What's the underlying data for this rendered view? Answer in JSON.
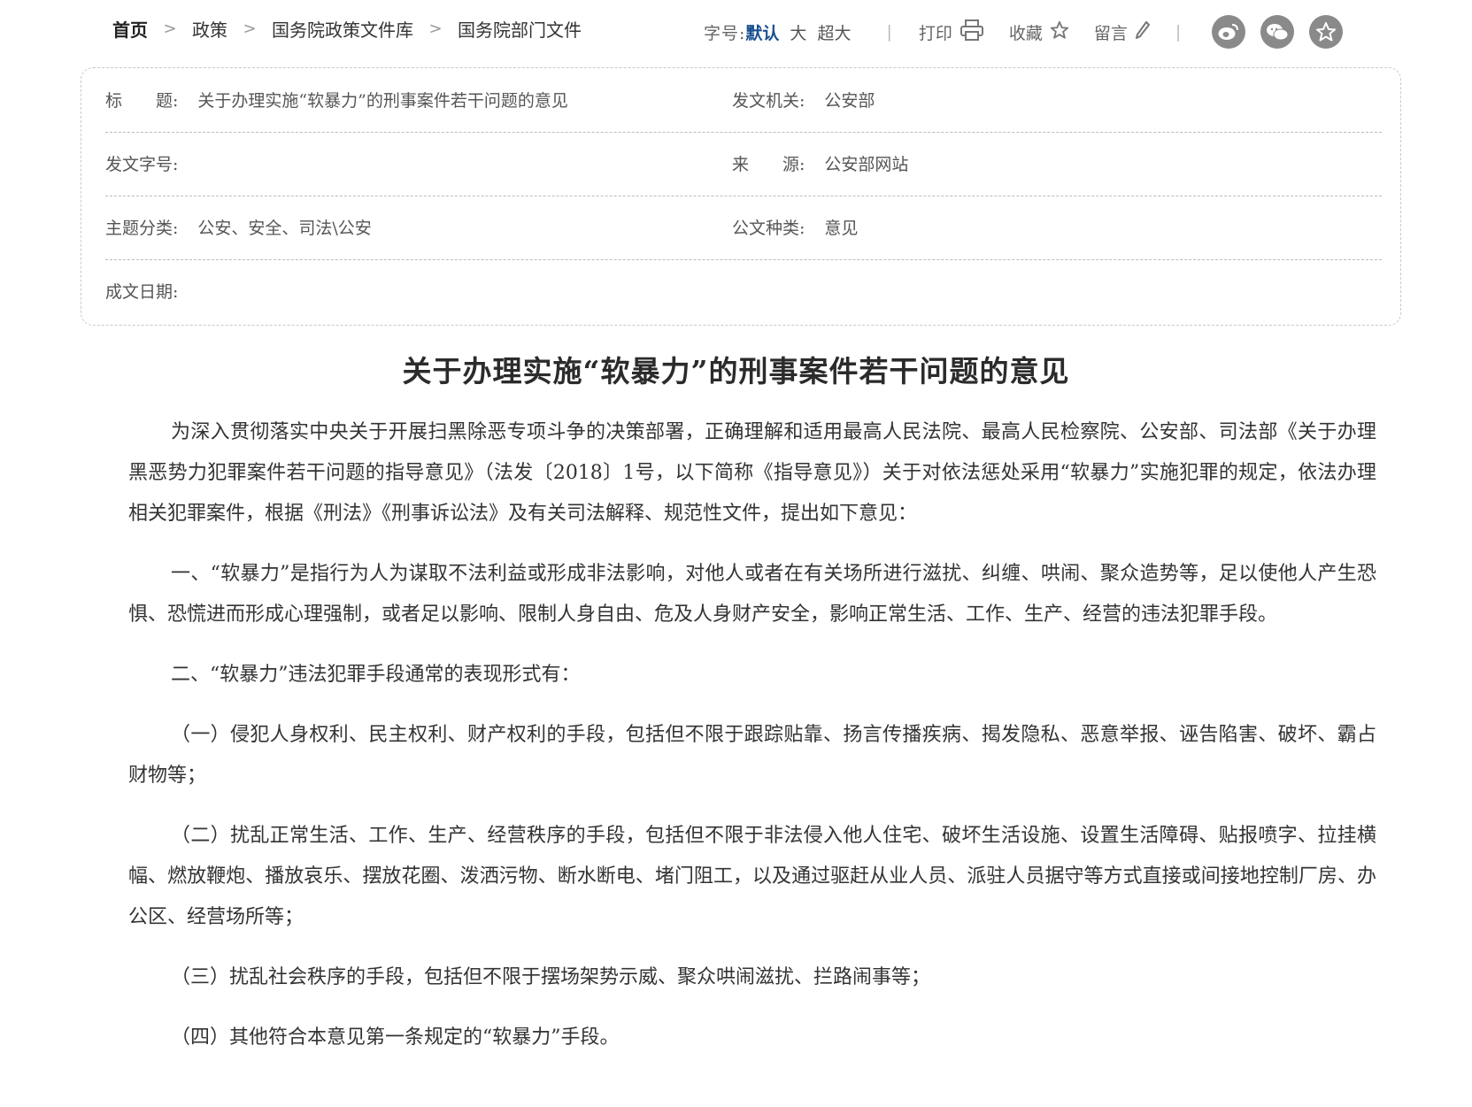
{
  "breadcrumb": {
    "home": "首页",
    "items": [
      "政策",
      "国务院政策文件库",
      "国务院部门文件"
    ],
    "separator": ">"
  },
  "toolbar": {
    "font_size_label": "字号:",
    "font_sizes": [
      "默认",
      "大",
      "超大"
    ],
    "active_font_size": "默认",
    "divider": "|",
    "print_label": "打印",
    "favorite_label": "收藏",
    "comment_label": "留言",
    "accent_color": "#1a4f8f",
    "share_icons": [
      "weibo-icon",
      "wechat-icon",
      "favorite-star-icon"
    ]
  },
  "meta": {
    "title_label": "标　　题:",
    "title_value": "关于办理实施“软暴力”的刑事案件若干问题的意见",
    "issuer_label": "发文机关:",
    "issuer_value": "公安部",
    "doc_number_label": "发文字号:",
    "doc_number_value": "",
    "source_label": "来　　源:",
    "source_value": "公安部网站",
    "topic_label": "主题分类:",
    "topic_value": "公安、安全、司法\\公安",
    "doc_type_label": "公文种类:",
    "doc_type_value": "意见",
    "date_label": "成文日期:",
    "date_value": ""
  },
  "article": {
    "title": "关于办理实施“软暴力”的刑事案件若干问题的意见",
    "paragraphs": [
      "为深入贯彻落实中央关于开展扫黑除恶专项斗争的决策部署，正确理解和适用最高人民法院、最高人民检察院、公安部、司法部《关于办理黑恶势力犯罪案件若干问题的指导意见》（法发〔2018〕1号，以下简称《指导意见》）关于对依法惩处采用“软暴力”实施犯罪的规定，依法办理相关犯罪案件，根据《刑法》《刑事诉讼法》及有关司法解释、规范性文件，提出如下意见：",
      "一、“软暴力”是指行为人为谋取不法利益或形成非法影响，对他人或者在有关场所进行滋扰、纠缠、哄闹、聚众造势等，足以使他人产生恐惧、恐慌进而形成心理强制，或者足以影响、限制人身自由、危及人身财产安全，影响正常生活、工作、生产、经营的违法犯罪手段。",
      "二、“软暴力”违法犯罪手段通常的表现形式有：",
      "（一）侵犯人身权利、民主权利、财产权利的手段，包括但不限于跟踪贴靠、扬言传播疾病、揭发隐私、恶意举报、诬告陷害、破坏、霸占财物等；",
      "（二）扰乱正常生活、工作、生产、经营秩序的手段，包括但不限于非法侵入他人住宅、破坏生活设施、设置生活障碍、贴报喷字、拉挂横幅、燃放鞭炮、播放哀乐、摆放花圈、泼洒污物、断水断电、堵门阻工，以及通过驱赶从业人员、派驻人员据守等方式直接或间接地控制厂房、办公区、经营场所等；",
      "（三）扰乱社会秩序的手段，包括但不限于摆场架势示威、聚众哄闹滋扰、拦路闹事等；",
      "（四）其他符合本意见第一条规定的“软暴力”手段。"
    ]
  }
}
